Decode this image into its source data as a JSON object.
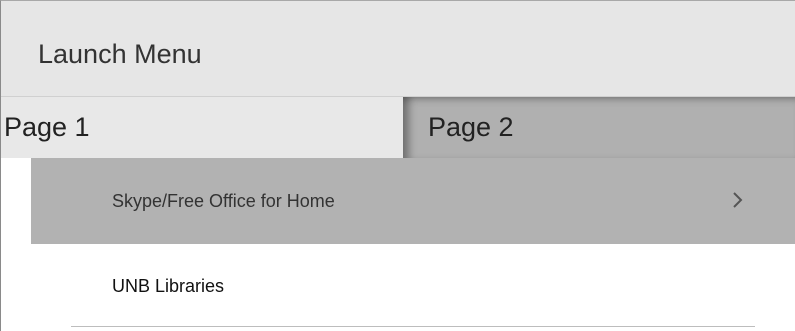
{
  "header": {
    "title": "Launch Menu"
  },
  "tabs": [
    {
      "label": "Page 1",
      "active": true
    },
    {
      "label": "Page 2",
      "active": false
    }
  ],
  "menu": {
    "items": [
      {
        "label": "Skype/Free Office for Home",
        "highlighted": true,
        "icon": "chevron-right-icon"
      },
      {
        "label": "UNB Libraries",
        "highlighted": false
      }
    ]
  },
  "colors": {
    "header_bg": "#e6e6e6",
    "active_tab_bg": "#e8e8e8",
    "inactive_tab_bg": "#b0b0b0",
    "highlight_bg": "#b2b2b2"
  }
}
